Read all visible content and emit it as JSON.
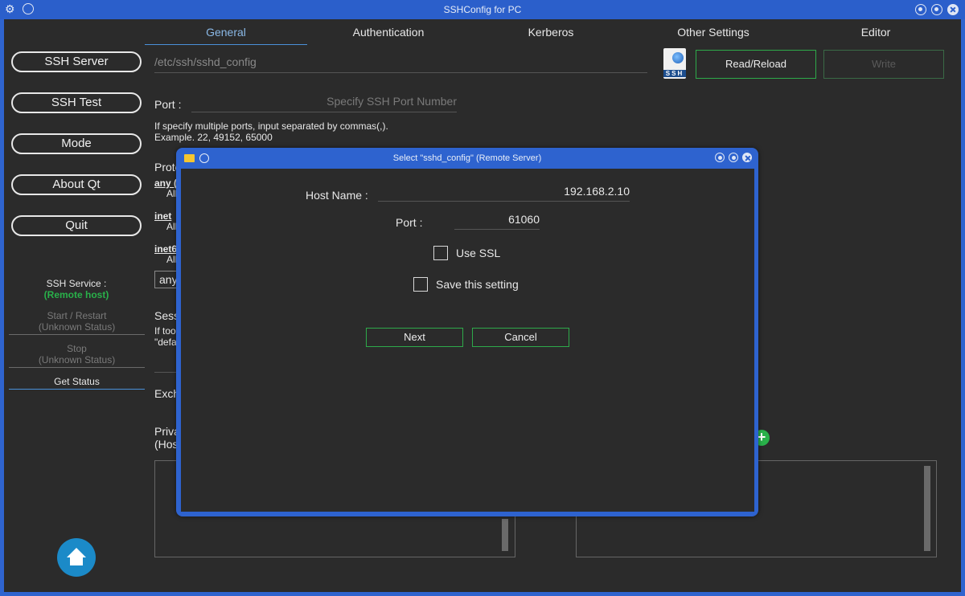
{
  "window": {
    "title": "SSHConfig for PC"
  },
  "sidebar": {
    "buttons": [
      "SSH Server",
      "SSH Test",
      "Mode",
      "About Qt",
      "Quit"
    ],
    "service_label": "SSH Service :",
    "service_host": "(Remote host)",
    "start_restart": "Start / Restart",
    "start_status": "(Unknown Status)",
    "stop": "Stop",
    "stop_status": "(Unknown Status)",
    "get_status": "Get Status"
  },
  "tabs": [
    "General",
    "Authentication",
    "Kerberos",
    "Other Settings",
    "Editor"
  ],
  "active_tab": "General",
  "toolbar": {
    "path_placeholder": "/etc/ssh/sshd_config",
    "ssh_icon_label": "SSH",
    "read_reload": "Read/Reload",
    "write": "Write"
  },
  "general": {
    "port_label": "Port :",
    "port_placeholder": "Specify SSH Port Number",
    "port_note_line1": "If specify multiple ports, input separated by commas(,).",
    "port_note_line2": "Example. 22, 49152, 65000",
    "frag_proto": "Proto",
    "frag_any": "any (",
    "frag_all1": "All",
    "frag_inet": "inet",
    "frag_all2": "All",
    "frag_inet6": "inet6",
    "frag_all3": "All",
    "frag_combo": "any",
    "frag_sess": "Sess",
    "frag_iftoo": "If too",
    "frag_defa": "\"defa",
    "frag_exch": "Exch",
    "frag_priva": "Priva",
    "frag_hos": "(Hos"
  },
  "dialog": {
    "title": "Select \"sshd_config\" (Remote Server)",
    "host_label": "Host Name :",
    "host_value": "192.168.2.10",
    "port_label": "Port :",
    "port_value": "61060",
    "use_ssl_label": "Use SSL",
    "use_ssl_checked": false,
    "save_setting_label": "Save this setting",
    "save_setting_checked": false,
    "next": "Next",
    "cancel": "Cancel"
  },
  "colors": {
    "accent_blue": "#2e63cf",
    "accent_green": "#2eaa4a",
    "background": "#2b2b2b"
  }
}
